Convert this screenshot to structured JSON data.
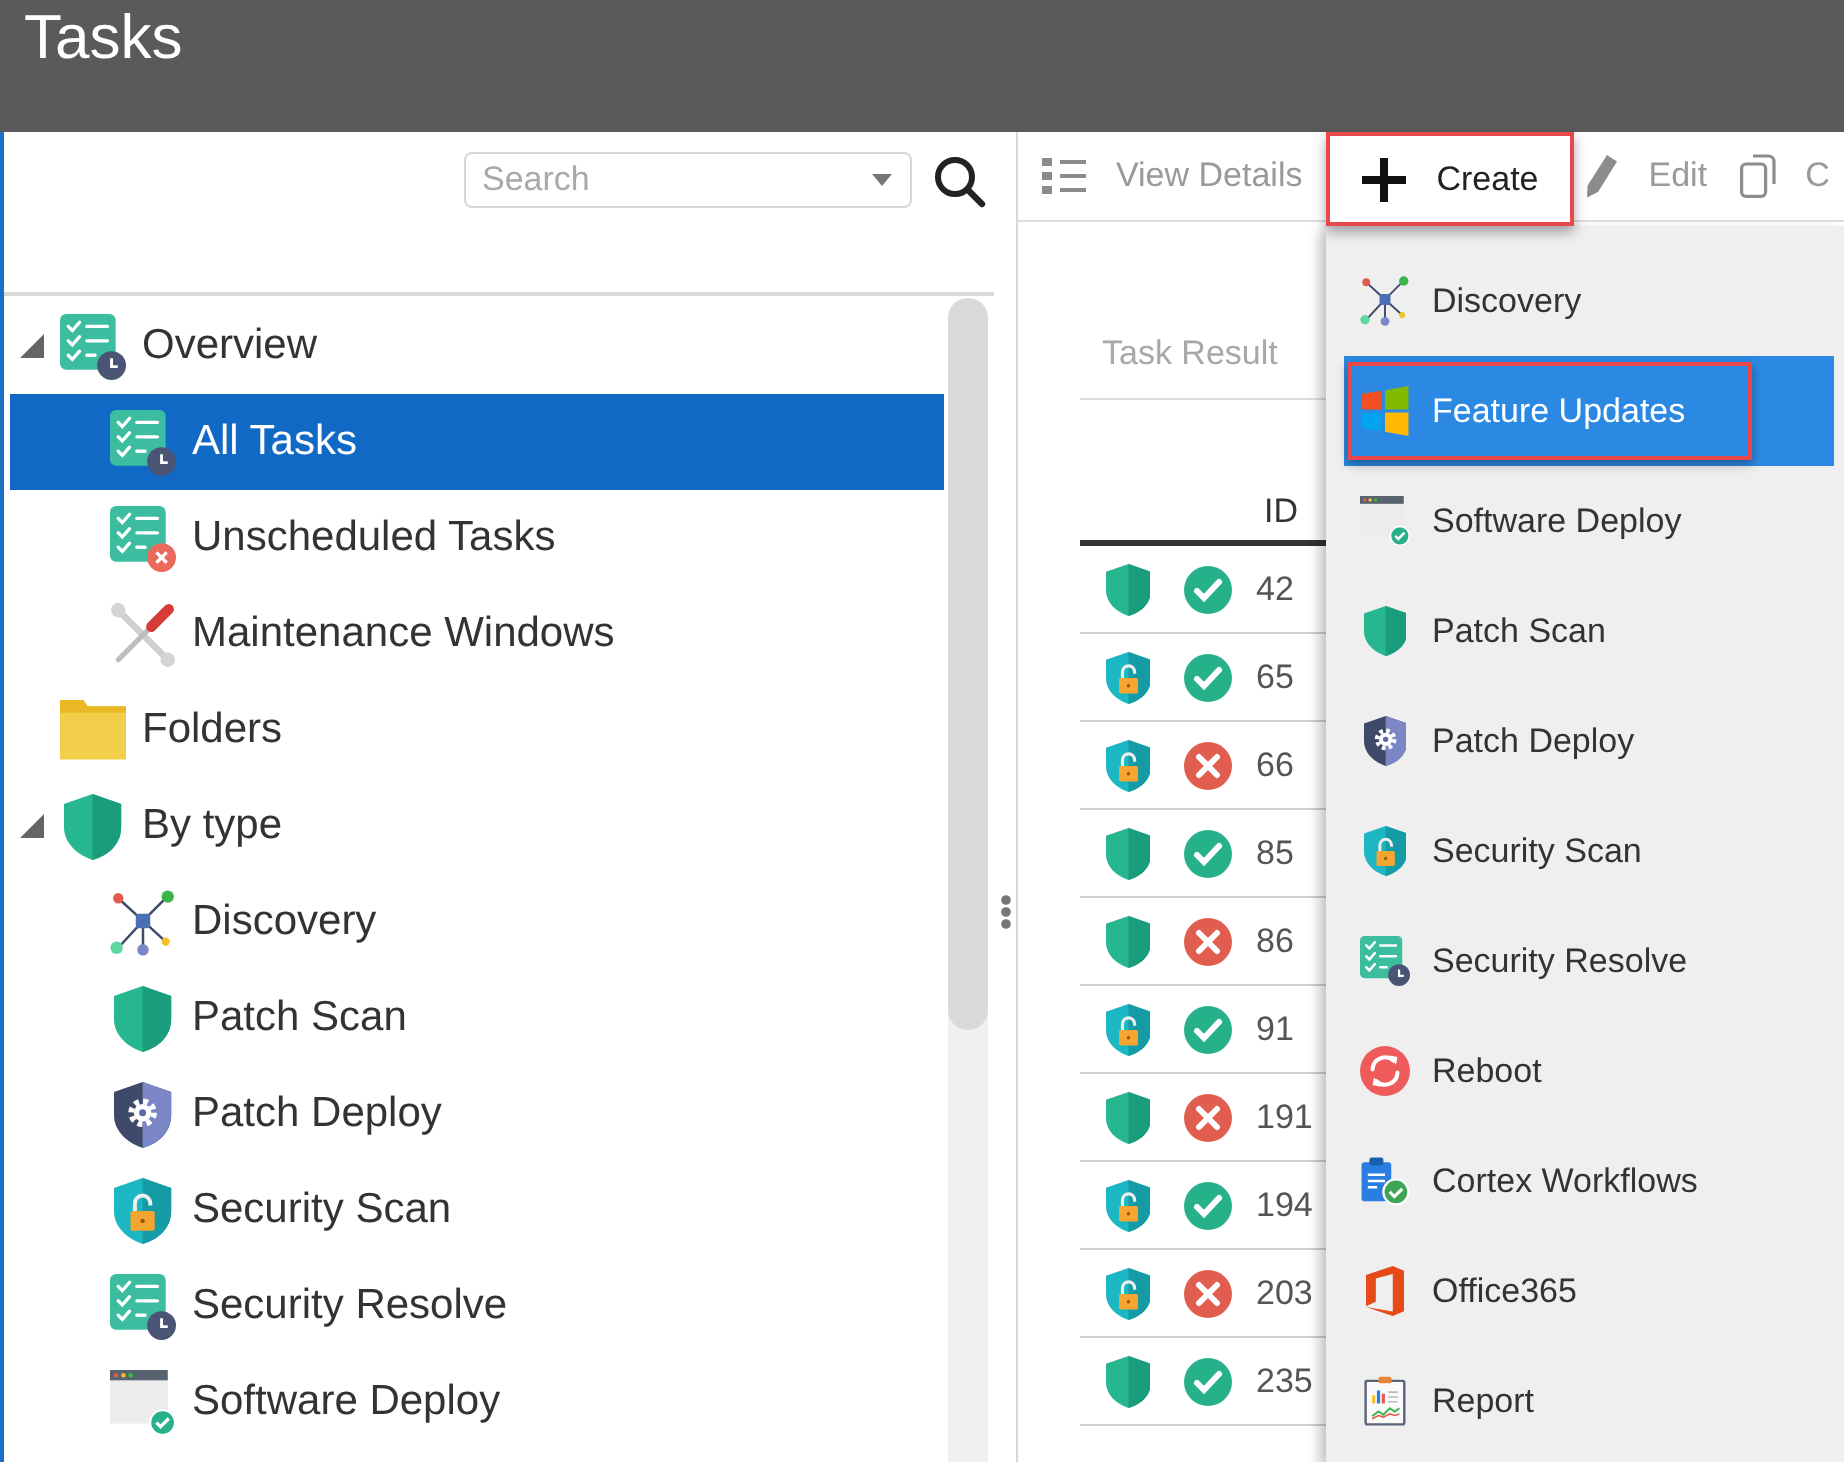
{
  "window": {
    "title": "Tasks"
  },
  "sidebar": {
    "search": {
      "placeholder": "Search"
    },
    "tree": [
      {
        "label": "Overview",
        "kind": "tasks",
        "selected": false,
        "expanded": true,
        "children": [
          {
            "label": "All Tasks",
            "kind": "tasks",
            "selected": true
          },
          {
            "label": "Unscheduled Tasks",
            "kind": "unscheduled",
            "selected": false
          },
          {
            "label": "Maintenance Windows",
            "kind": "tools",
            "selected": false
          }
        ]
      },
      {
        "label": "Folders",
        "kind": "folder",
        "selected": false
      },
      {
        "label": "By type",
        "kind": "shield",
        "selected": false,
        "expanded": true,
        "children": [
          {
            "label": "Discovery",
            "kind": "discovery",
            "selected": false
          },
          {
            "label": "Patch Scan",
            "kind": "shield",
            "selected": false
          },
          {
            "label": "Patch Deploy",
            "kind": "deploy",
            "selected": false
          },
          {
            "label": "Security Scan",
            "kind": "security",
            "selected": false
          },
          {
            "label": "Security Resolve",
            "kind": "tasks",
            "selected": false
          },
          {
            "label": "Software Deploy",
            "kind": "software",
            "selected": false
          }
        ]
      }
    ]
  },
  "toolbar": {
    "items": [
      {
        "label": "View Details",
        "kind": "details",
        "disabled": true,
        "highlighted": false
      },
      {
        "label": "Create",
        "kind": "create",
        "disabled": false,
        "highlighted": true
      },
      {
        "label": "Edit",
        "kind": "edit",
        "disabled": true,
        "highlighted": false
      },
      {
        "label": "C",
        "kind": "copy",
        "disabled": true,
        "highlighted": false
      }
    ]
  },
  "results": {
    "section_title": "Task Result",
    "id_header": "ID",
    "rows": [
      {
        "kind": "shield",
        "failed": false,
        "id": "42"
      },
      {
        "kind": "security",
        "failed": false,
        "id": "65"
      },
      {
        "kind": "security",
        "failed": true,
        "id": "66"
      },
      {
        "kind": "shield",
        "failed": false,
        "id": "85"
      },
      {
        "kind": "shield",
        "failed": true,
        "id": "86"
      },
      {
        "kind": "security",
        "failed": false,
        "id": "91"
      },
      {
        "kind": "shield",
        "failed": true,
        "id": "191"
      },
      {
        "kind": "security",
        "failed": false,
        "id": "194"
      },
      {
        "kind": "security",
        "failed": true,
        "id": "203"
      },
      {
        "kind": "shield",
        "failed": false,
        "id": "235"
      }
    ]
  },
  "create_menu": {
    "items": [
      {
        "label": "Discovery",
        "kind": "discovery",
        "selected": false,
        "highlighted": false
      },
      {
        "label": "Feature Updates",
        "kind": "windows",
        "selected": true,
        "highlighted": true
      },
      {
        "label": "Software Deploy",
        "kind": "software",
        "selected": false,
        "highlighted": false
      },
      {
        "label": "Patch Scan",
        "kind": "shield",
        "selected": false,
        "highlighted": false
      },
      {
        "label": "Patch Deploy",
        "kind": "deploy",
        "selected": false,
        "highlighted": false
      },
      {
        "label": "Security Scan",
        "kind": "security",
        "selected": false,
        "highlighted": false
      },
      {
        "label": "Security Resolve",
        "kind": "tasks",
        "selected": false,
        "highlighted": false
      },
      {
        "label": "Reboot",
        "kind": "reboot",
        "selected": false,
        "highlighted": false
      },
      {
        "label": "Cortex Workflows",
        "kind": "workflow",
        "selected": false,
        "highlighted": false
      },
      {
        "label": "Office365",
        "kind": "office",
        "selected": false,
        "highlighted": false
      },
      {
        "label": "Report",
        "kind": "report",
        "selected": false,
        "highlighted": false
      }
    ]
  }
}
